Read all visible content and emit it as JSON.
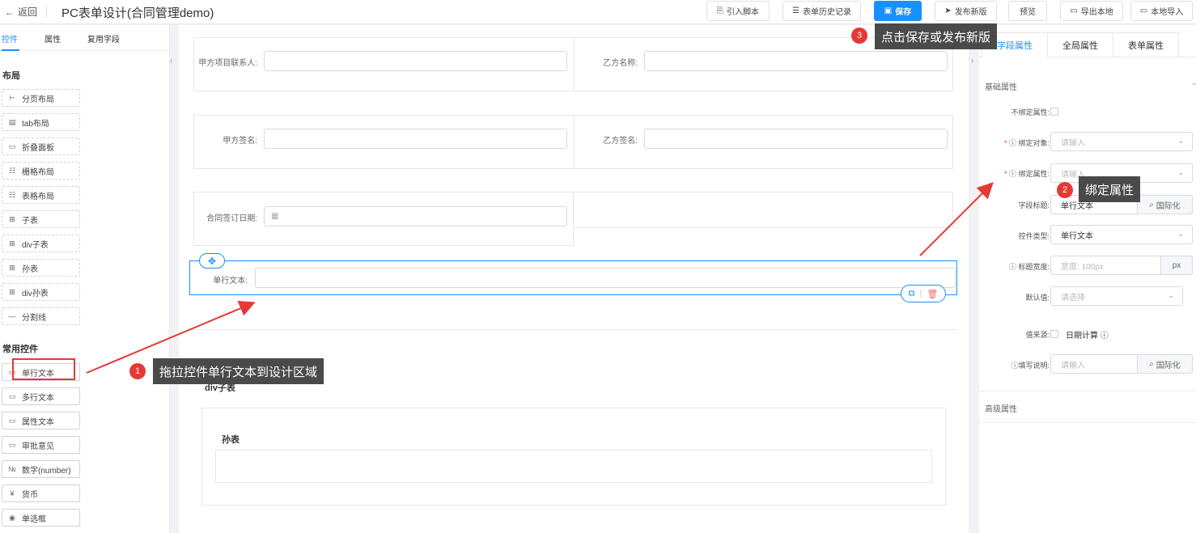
{
  "header": {
    "back_label": "返回",
    "title": "PC表单设计(合同管理demo)",
    "buttons": {
      "import_script": "引入脚本",
      "history": "表单历史记录",
      "save": "保存",
      "publish": "发布新版",
      "preview": "预览",
      "export_local": "导出本地",
      "import_local": "本地导入"
    }
  },
  "left": {
    "tabs": [
      "控件",
      "属性",
      "复用字段"
    ],
    "layout_title": "布局",
    "layout_items": [
      {
        "label": "分页布局",
        "icon": "split-icon"
      },
      {
        "label": "tab布局",
        "icon": "tab-icon"
      },
      {
        "label": "折叠面板",
        "icon": "panel-icon"
      },
      {
        "label": "栅格布局",
        "icon": "grid-icon"
      },
      {
        "label": "表格布局",
        "icon": "table-layout-icon"
      },
      {
        "label": "子表",
        "icon": "table-icon"
      },
      {
        "label": "div子表",
        "icon": "table-icon"
      },
      {
        "label": "孙表",
        "icon": "table-icon"
      },
      {
        "label": "div孙表",
        "icon": "table-icon"
      },
      {
        "label": "分割线",
        "icon": "divider-icon"
      }
    ],
    "common_title": "常用控件",
    "common_items": [
      {
        "label": "单行文本",
        "icon": "input-icon"
      },
      {
        "label": "多行文本",
        "icon": "input-icon"
      },
      {
        "label": "属性文本",
        "icon": "input-icon"
      },
      {
        "label": "审批意见",
        "icon": "input-icon"
      },
      {
        "label": "数字(number)",
        "icon": "number-icon"
      },
      {
        "label": "货币",
        "icon": "currency-icon"
      },
      {
        "label": "单选框",
        "icon": "radio-icon"
      }
    ]
  },
  "canvas": {
    "row1": {
      "left_label": "甲方项目联系人:",
      "right_label": "乙方名称:"
    },
    "row2": {
      "left_label": "甲方签名:",
      "right_label": "乙方签名:"
    },
    "row3": {
      "left_label": "合同签订日期:"
    },
    "selected": {
      "label": "单行文本:"
    },
    "div_subtable": "div子表",
    "grandchild": "孙表"
  },
  "callouts": {
    "c1": {
      "num": "1",
      "text": "拖拉控件单行文本到设计区域"
    },
    "c2": {
      "num": "2",
      "text": "绑定属性"
    },
    "c3": {
      "num": "3",
      "text": "点击保存或发布新版"
    }
  },
  "right": {
    "tabs": [
      "字段属性",
      "全局属性",
      "表单属性"
    ],
    "basic_title": "基础属性",
    "unbound_label": "不绑定属性:",
    "bind_object_label": "绑定对象:",
    "bind_object_placeholder": "请输入",
    "bind_prop_label": "绑定属性:",
    "bind_prop_placeholder": "请输入",
    "field_title_label": "字段标题:",
    "field_title_value": "单行文本",
    "i18n_label": "国际化",
    "ctrl_type_label": "控件类型:",
    "ctrl_type_value": "单行文本",
    "title_width_label": "标题宽度:",
    "title_width_placeholder": "宽度: 100px",
    "unit_px": "px",
    "default_label": "默认值:",
    "default_placeholder": "请选择",
    "source_label": "值来源:",
    "date_calc_label": "日期计算",
    "fill_hint_label": "填写说明:",
    "fill_hint_placeholder": "请输入",
    "advanced_title": "高级属性"
  },
  "colors": {
    "primary": "#1890ff",
    "callout_bg": "#4a4a4a",
    "badge": "#e53935"
  }
}
